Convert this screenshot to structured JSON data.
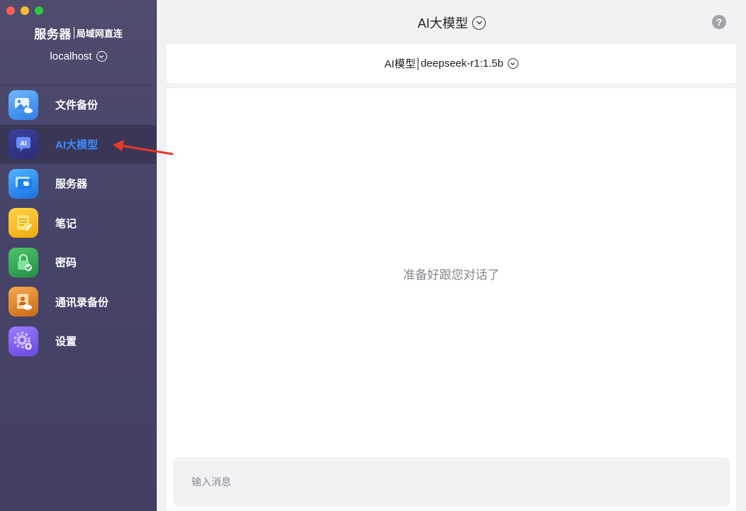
{
  "window": {
    "traffic_lights": [
      "close",
      "minimize",
      "zoom"
    ]
  },
  "sidebar": {
    "title": "服务器",
    "subtitle": "局域网直连",
    "host": "localhost",
    "items": [
      {
        "label": "文件备份",
        "icon": "photo-cloud-icon",
        "active": false
      },
      {
        "label": "AI大模型",
        "icon": "ai-chat-icon",
        "active": true
      },
      {
        "label": "服务器",
        "icon": "server-apple-icon",
        "active": false
      },
      {
        "label": "笔记",
        "icon": "notes-icon",
        "active": false
      },
      {
        "label": "密码",
        "icon": "lock-check-icon",
        "active": false
      },
      {
        "label": "通讯录备份",
        "icon": "contacts-icon",
        "active": false
      },
      {
        "label": "设置",
        "icon": "gear-icon",
        "active": false
      }
    ]
  },
  "header": {
    "title": "AI大模型",
    "help": "?"
  },
  "model_selector": {
    "label": "AI模型",
    "value": "deepseek-r1:1.5b"
  },
  "chat": {
    "empty_message": "准备好跟您对话了",
    "input_placeholder": "输入消息"
  },
  "colors": {
    "sidebar_bg": "#4b4869",
    "active_text": "#3d8bff",
    "annotation_arrow": "#e8392b"
  }
}
